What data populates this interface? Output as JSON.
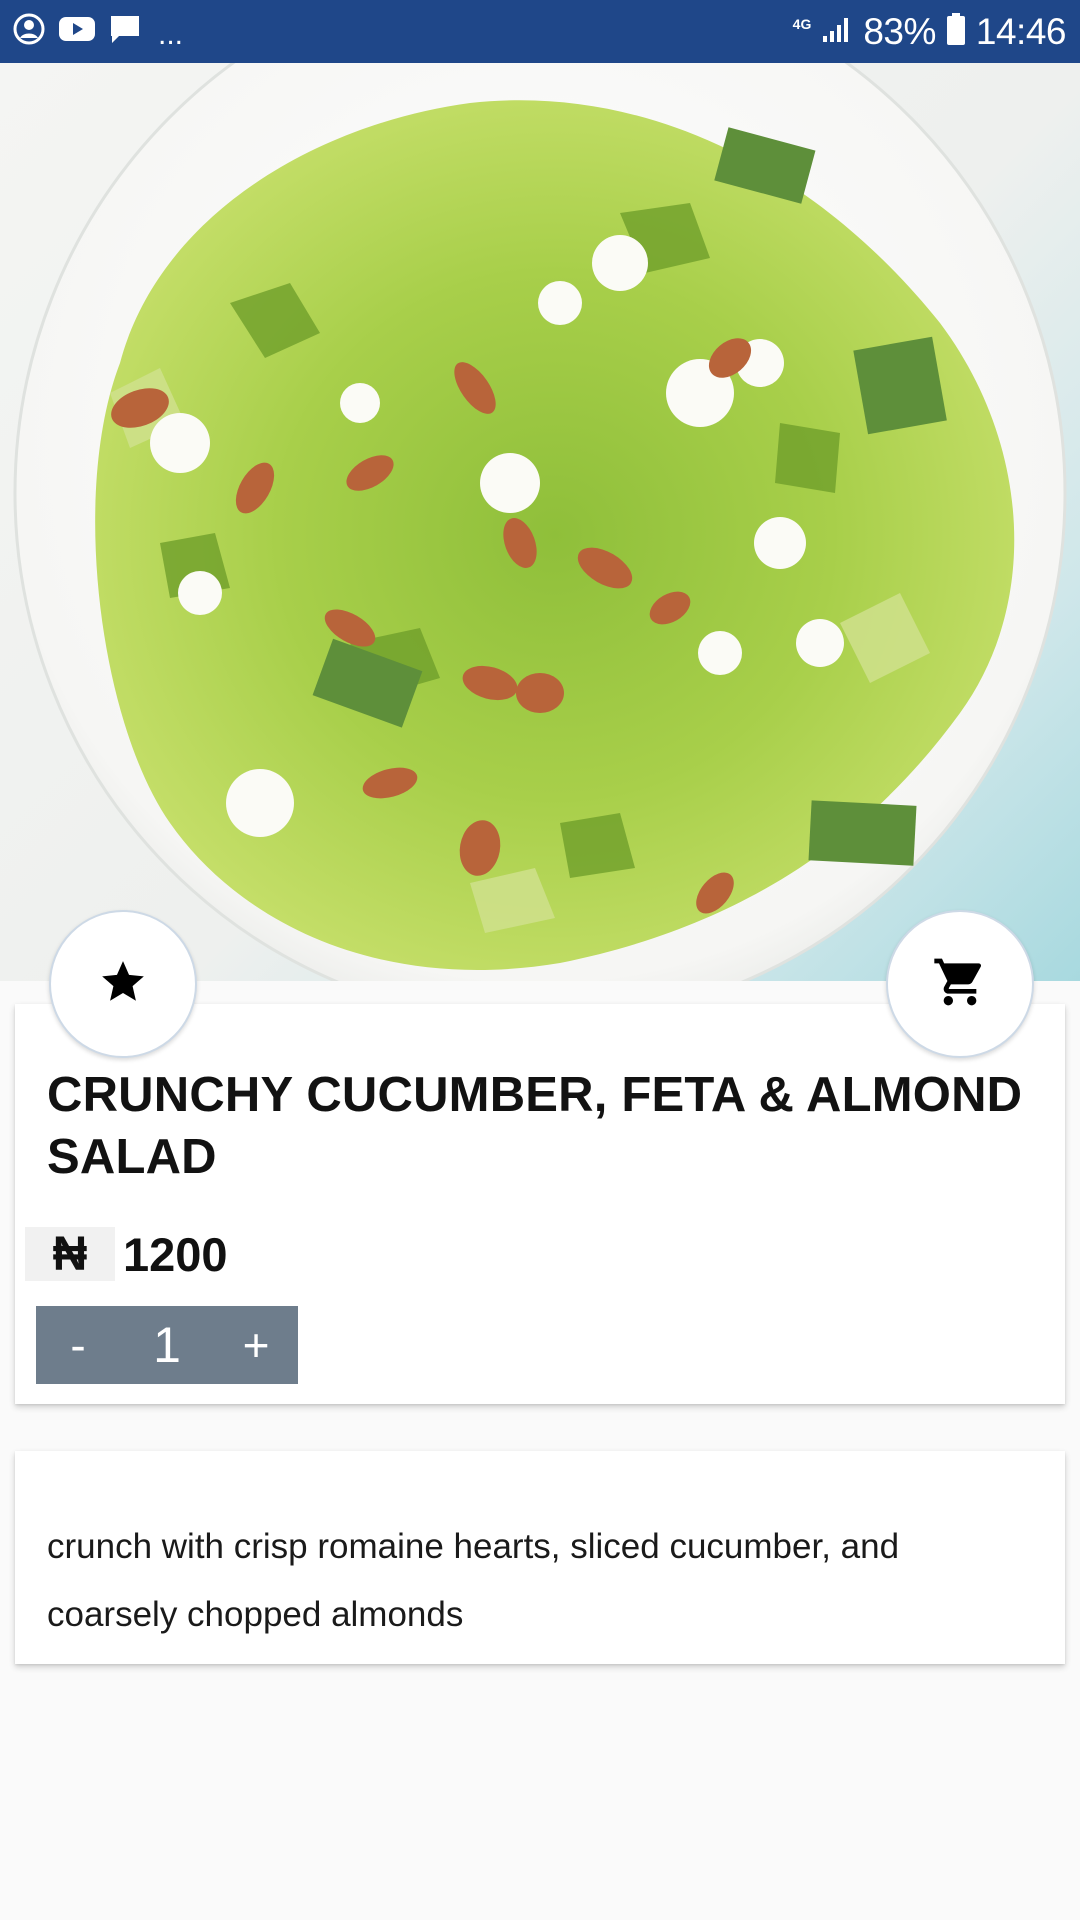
{
  "status_bar": {
    "overflow_dots": "...",
    "network": "4G",
    "battery": "83%",
    "time": "14:46",
    "icons": [
      "account-circle-icon",
      "youtube-icon",
      "message-icon",
      "signal-icon",
      "battery-icon"
    ]
  },
  "product": {
    "title": "CRUNCHY CUCUMBER, FETA & ALMOND SALAD",
    "currency_symbol": "₦",
    "price": "1200",
    "quantity": "1",
    "decrement_label": "-",
    "increment_label": "+"
  },
  "description": {
    "text": "crunch with crisp romaine hearts, sliced cucumber, and coarsely chopped almonds"
  },
  "actions": {
    "favorite_icon": "star-icon",
    "cart_icon": "cart-icon"
  },
  "colors": {
    "status_bar": "#1f4789",
    "stepper": "#6e7d8c",
    "background": "#fafafa"
  }
}
